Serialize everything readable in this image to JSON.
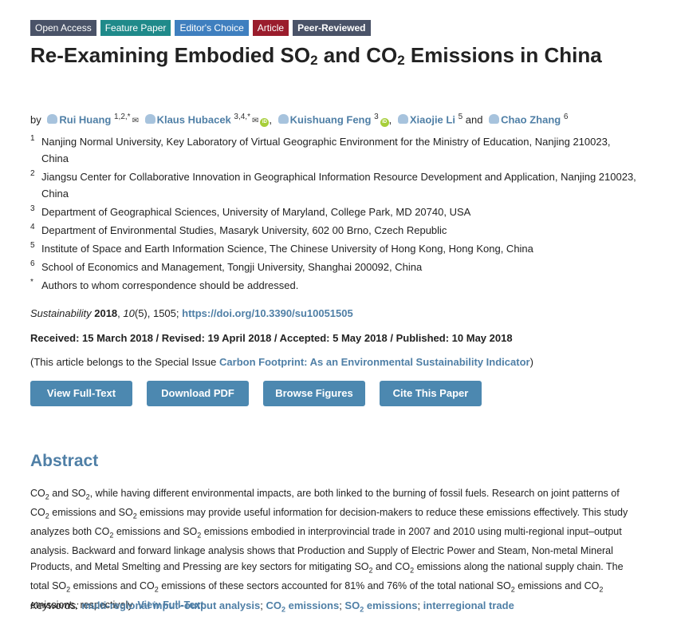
{
  "badges": {
    "open": "Open Access",
    "feature": "Feature Paper",
    "editor": "Editor's Choice",
    "article": "Article",
    "peer": "Peer-Reviewed"
  },
  "title": {
    "part1": "Re-Examining Embodied SO",
    "sub1": "2",
    "part2": " and CO",
    "sub2": "2",
    "part3": " Emissions in China"
  },
  "authors": {
    "by": "by",
    "a1_name": "Rui Huang",
    "a1_sup": "1,2,*",
    "a2_name": "Klaus Hubacek",
    "a2_sup": "3,4,*",
    "a3_name": "Kuishuang Feng",
    "a3_sup": "3",
    "a4_name": "Xiaojie Li",
    "a4_sup": "5",
    "and": "and",
    "a5_name": "Chao Zhang",
    "a5_sup": "6",
    "orcid_text": "iD",
    "envelope": "✉"
  },
  "affiliations": [
    {
      "num": "1",
      "text": "Nanjing Normal University, Key Laboratory of Virtual Geographic Environment for the Ministry of Education, Nanjing 210023, China"
    },
    {
      "num": "2",
      "text": "Jiangsu Center for Collaborative Innovation in Geographical Information Resource Development and Application, Nanjing 210023, China"
    },
    {
      "num": "3",
      "text": "Department of Geographical Sciences, University of Maryland, College Park, MD 20740, USA"
    },
    {
      "num": "4",
      "text": "Department of Environmental Studies, Masaryk University, 602 00 Brno, Czech Republic"
    },
    {
      "num": "5",
      "text": "Institute of Space and Earth Information Science, The Chinese University of Hong Kong, Hong Kong, China"
    },
    {
      "num": "6",
      "text": "School of Economics and Management, Tongji University, Shanghai 200092, China"
    },
    {
      "num": "*",
      "text": "Authors to whom correspondence should be addressed."
    }
  ],
  "citation": {
    "journal": "Sustainability",
    "year": "2018",
    "volume": "10",
    "rest": "(5), 1505; ",
    "doi": "https://doi.org/10.3390/su10051505"
  },
  "dates": "Received: 15 March 2018 / Revised: 19 April 2018 / Accepted: 5 May 2018 / Published: 10 May 2018",
  "special": {
    "prefix": "(This article belongs to the Special Issue ",
    "link": "Carbon Footprint: As an Environmental Sustainability Indicator",
    "suffix": ")"
  },
  "buttons": {
    "full_text": "View Full-Text",
    "pdf": "Download PDF",
    "figures": "Browse Figures",
    "cite": "Cite This Paper"
  },
  "abstract": {
    "heading": "Abstract",
    "text": [
      "CO",
      "2",
      " and SO",
      "2",
      ", while having different environmental impacts, are both linked to the burning of fossil fuels. Research on joint patterns of CO",
      "2",
      " emissions and SO",
      "2",
      " emissions may provide useful information for decision-makers to reduce these emissions effectively. This study analyzes both CO",
      "2",
      " emissions and SO",
      "2",
      " emissions embodied in interprovincial trade in 2007 and 2010 using multi-regional input–output analysis. Backward and forward linkage analysis shows that Production and Supply of Electric Power and Steam, Non-metal Mineral Products, and Metal Smelting and Pressing are key sectors for mitigating SO",
      "2",
      " and CO",
      "2",
      " emissions along the national supply chain. The total SO",
      "2",
      " emissions and CO",
      "2",
      " emissions of these sectors accounted for 81% and 76% of the total national SO",
      "2",
      " emissions and CO",
      "2",
      " emissions, respectively. "
    ],
    "view_full_text": "View Full-Text"
  },
  "keywords": {
    "label": "Keywords:",
    "k1": "multi-regional input–output analysis",
    "k2a": "CO",
    "k2sub": "2",
    "k2b": " emissions",
    "k3a": "SO",
    "k3sub": "2",
    "k3b": " emissions",
    "k4": "interregional trade",
    "sep": "; "
  }
}
